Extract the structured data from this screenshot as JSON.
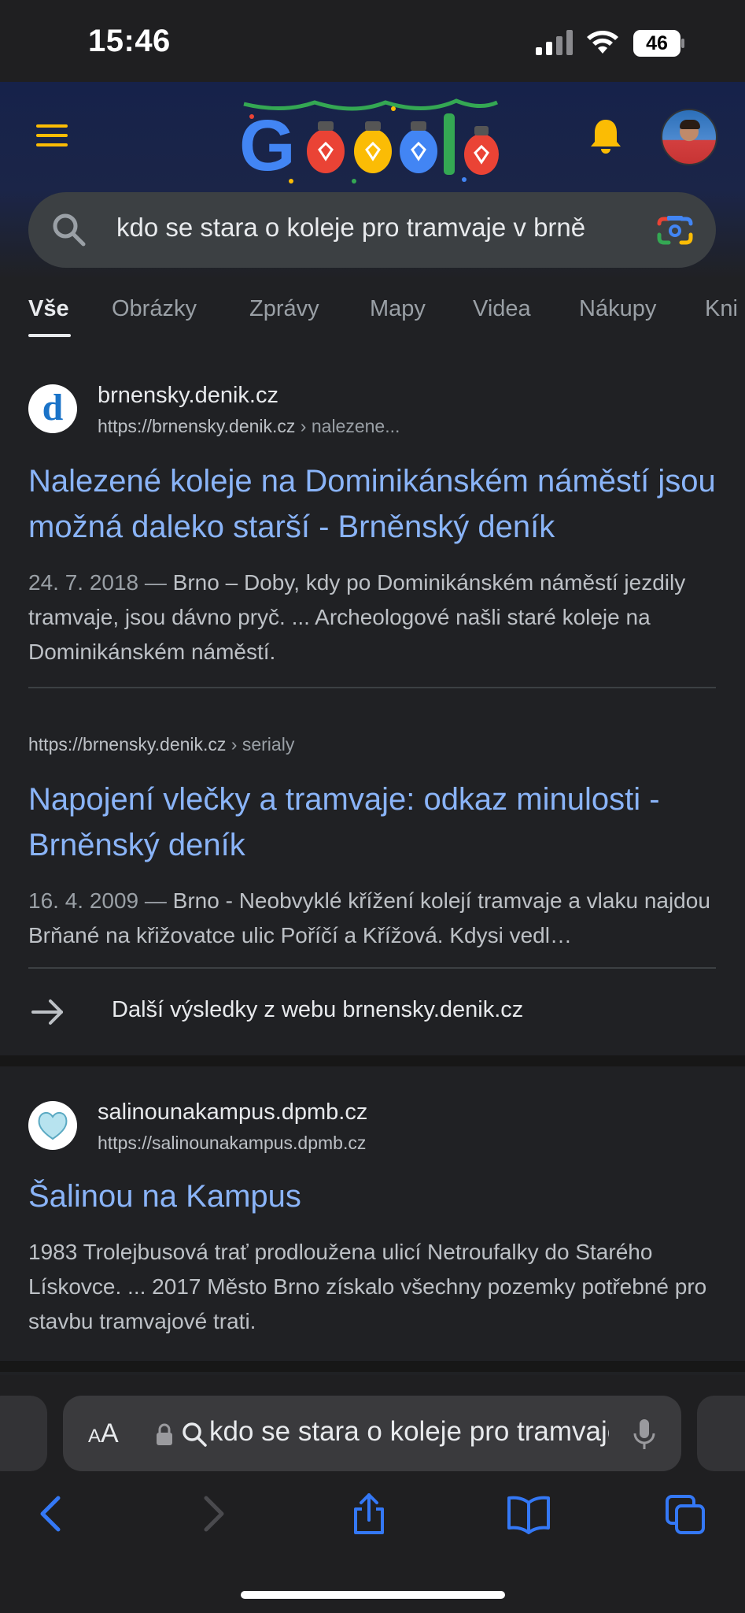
{
  "status_bar": {
    "time": "15:46",
    "battery": "46"
  },
  "header": {
    "logo_text": "Google",
    "search": {
      "query": "kdo se stara o koleje pro tramvaje v brně"
    }
  },
  "tabs": [
    {
      "label": "Vše"
    },
    {
      "label": "Obrázky"
    },
    {
      "label": "Zprávy"
    },
    {
      "label": "Mapy"
    },
    {
      "label": "Videa"
    },
    {
      "label": "Nákupy"
    },
    {
      "label": "Kni"
    }
  ],
  "results": [
    {
      "icon_letter": "d",
      "site_name": "brnensky.denik.cz",
      "url": "https://brnensky.denik.cz",
      "crumb": " › nalezene...",
      "title": "Nalezené koleje na Dominikánském náměstí jsou možná daleko starší - Brněnský deník",
      "date": "24. 7. 2018 —",
      "snippet": " Brno – Doby, kdy po Dominikánském náměstí jezdily tramvaje, jsou dávno pryč. ... Archeologové našli staré koleje na Dominikánském náměstí."
    },
    {
      "url": "https://brnensky.denik.cz",
      "crumb": " › serialy",
      "title": "Napojení vlečky a tramvaje: odkaz minulosti - Brněnský deník",
      "date": "16. 4. 2009 —",
      "snippet": " Brno - Neobvyklé křížení kolejí tramvaje a vlaku najdou Brňané na křižovatce ulic Poříčí a Křížová. Kdysi vedl…"
    },
    {
      "site_name": "salinounakampus.dpmb.cz",
      "url": "https://salinounakampus.dpmb.cz",
      "title": "Šalinou na Kampus",
      "snippet": "1983 Trolejbusová trať prodloužena ulicí Netroufalky do Starého Lískovce. ... 2017 Město Brno získalo všechny pozemky potřebné pro stavbu tramvajové trati."
    }
  ],
  "more_results": {
    "label": "Další výsledky z webu brnensky.denik.cz"
  },
  "safari": {
    "aa_small": "A",
    "aa_large": "A",
    "url_text": "kdo se stara o koleje pro tramvaje v brně"
  },
  "colors": {
    "link": "#8ab4f8",
    "background": "#202124",
    "header": "#16224a",
    "accent": "#fbbc04"
  }
}
